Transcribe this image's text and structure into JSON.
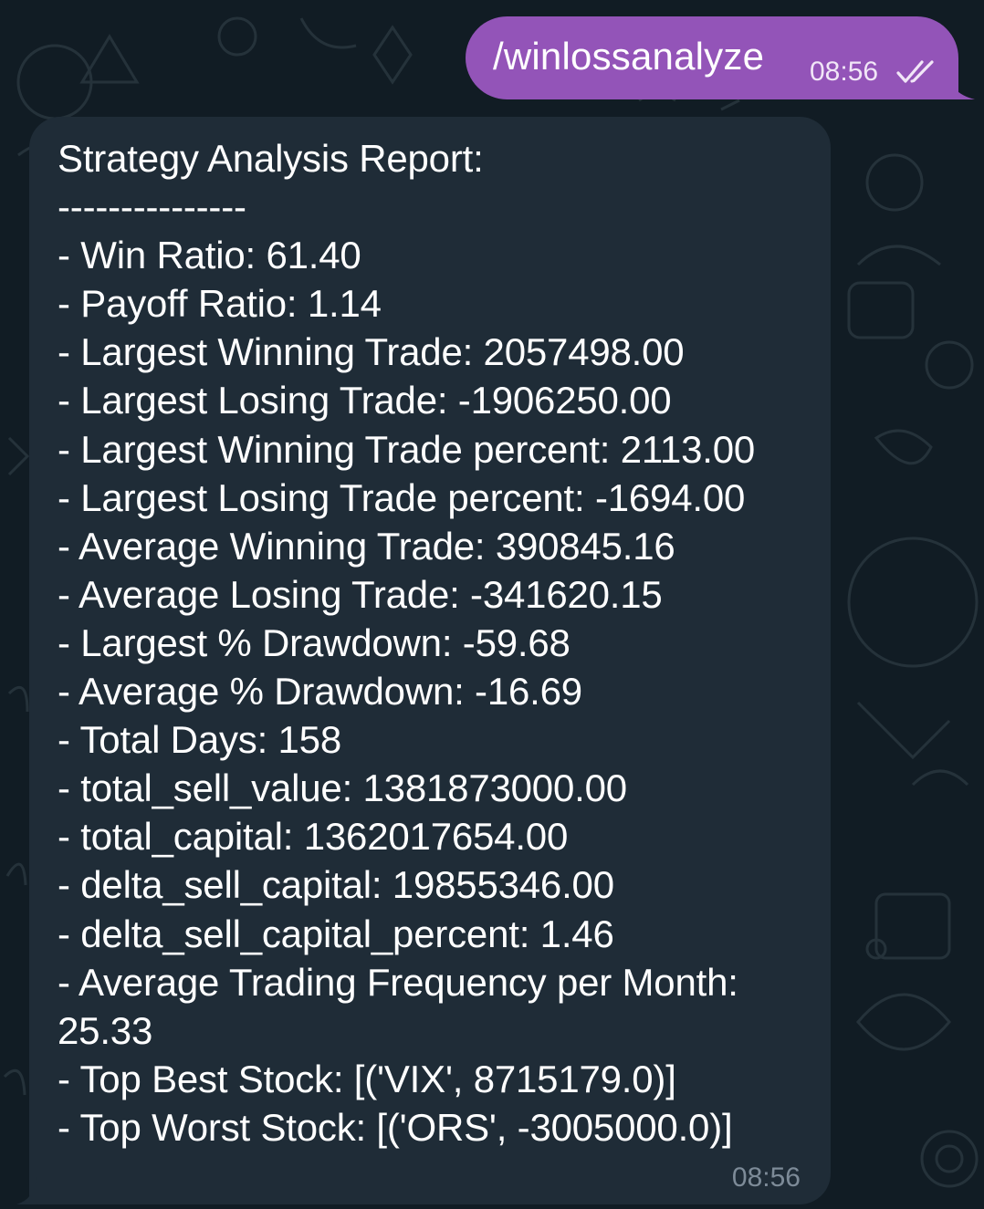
{
  "outgoing_message": {
    "text": "/winlossanalyze",
    "time": "08:56",
    "status_icon": "double-check-icon",
    "bubble_color": "#9354b8"
  },
  "incoming_message": {
    "lines": [
      "Strategy Analysis Report:",
      "---------------",
      "- Win Ratio: 61.40",
      "- Payoff Ratio: 1.14",
      "- Largest Winning Trade: 2057498.00",
      "- Largest Losing Trade: -1906250.00",
      "- Largest Winning Trade percent: 2113.00",
      "- Largest Losing Trade percent: -1694.00",
      "- Average Winning Trade: 390845.16",
      "- Average Losing Trade: -341620.15",
      "- Largest % Drawdown: -59.68",
      "- Average % Drawdown: -16.69",
      "- Total Days: 158",
      "- total_sell_value: 1381873000.00",
      "- total_capital: 1362017654.00",
      "- delta_sell_capital: 19855346.00",
      "- delta_sell_capital_percent: 1.46",
      "- Average Trading Frequency per Month:",
      "25.33",
      "- Top Best Stock: [('VIX', 8715179.0)]",
      "- Top Worst Stock: [('ORS', -3005000.0)]"
    ],
    "time": "08:56",
    "bubble_color": "#1f2c37"
  },
  "colors": {
    "chat_background": "#111c24",
    "timestamp_muted": "#7d8b98"
  }
}
